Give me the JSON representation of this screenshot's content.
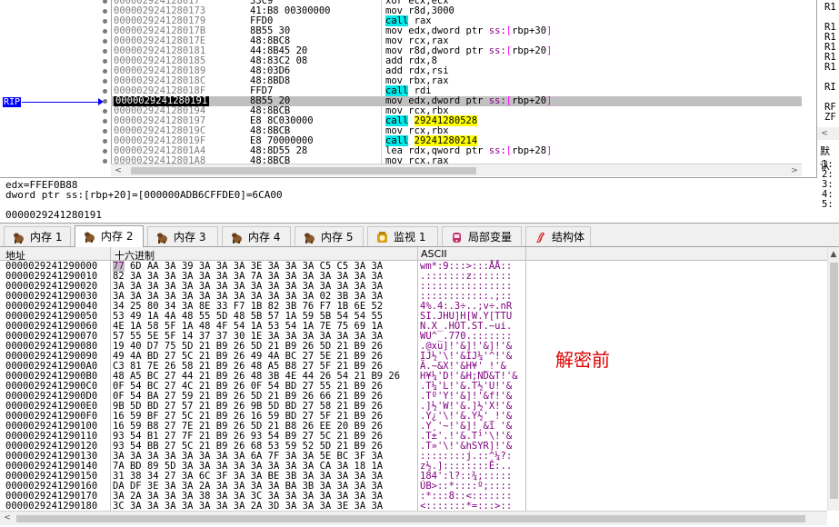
{
  "disasm": {
    "rip_label": "RIP",
    "rows": [
      {
        "addr": "000002924128017",
        "bytes": "33C9",
        "instr": "xor ecx,ecx"
      },
      {
        "addr": "0000029241280173",
        "bytes": "41:B8 00300000",
        "instr": "mov r8d,3000"
      },
      {
        "addr": "0000029241280179",
        "bytes": "FFD0",
        "instr": "call rax"
      },
      {
        "addr": "000002924128017B",
        "bytes": "8B55 30",
        "instr": "mov edx,dword ptr ss:[rbp+30]"
      },
      {
        "addr": "000002924128017E",
        "bytes": "48:8BC8",
        "instr": "mov rcx,rax"
      },
      {
        "addr": "0000029241280181",
        "bytes": "44:8B45 20",
        "instr": "mov r8d,dword ptr ss:[rbp+20]"
      },
      {
        "addr": "0000029241280185",
        "bytes": "48:83C2 08",
        "instr": "add rdx,8"
      },
      {
        "addr": "0000029241280189",
        "bytes": "48:03D6",
        "instr": "add rdx,rsi"
      },
      {
        "addr": "000002924128018C",
        "bytes": "48:8BD8",
        "instr": "mov rbx,rax"
      },
      {
        "addr": "000002924128018F",
        "bytes": "FFD7",
        "instr": "call rdi"
      },
      {
        "addr": "0000029241280191",
        "bytes": "8B55 20",
        "instr": "mov edx,dword ptr ss:[rbp+20]"
      },
      {
        "addr": "0000029241280194",
        "bytes": "48:8BCB",
        "instr": "mov rcx,rbx"
      },
      {
        "addr": "0000029241280197",
        "bytes": "E8 8C030000",
        "instr": "call 29241280528"
      },
      {
        "addr": "000002924128019C",
        "bytes": "48:8BCB",
        "instr": "mov rcx,rbx"
      },
      {
        "addr": "000002924128019F",
        "bytes": "E8 70000000",
        "instr": "call 29241280214"
      },
      {
        "addr": "00000292412801A4",
        "bytes": "48:8D55 28",
        "instr": "lea rdx,qword ptr ss:[rbp+28]"
      },
      {
        "addr": "00000292412801A8",
        "bytes": "48:8BCB",
        "instr": "mov rcx,rax"
      }
    ]
  },
  "registers": {
    "labels": [
      "R1",
      "R1",
      "R1",
      "R1",
      "R1",
      "R1",
      "RI",
      "RF",
      "ZF"
    ],
    "default_label": "默认",
    "stack": [
      "1:",
      "2:",
      "3:",
      "4:",
      "5:"
    ]
  },
  "info": {
    "line1": "edx=FFEF0B88",
    "line2": "dword ptr ss:[rbp+20]=[000000ADB6CFFDE0]=6CA00",
    "line3": "0000029241280191"
  },
  "tabs": [
    {
      "label": "内存 1",
      "icon": "memory-icon"
    },
    {
      "label": "内存 2",
      "icon": "memory-icon"
    },
    {
      "label": "内存 3",
      "icon": "memory-icon"
    },
    {
      "label": "内存 4",
      "icon": "memory-icon"
    },
    {
      "label": "内存 5",
      "icon": "memory-icon"
    },
    {
      "label": "监视 1",
      "icon": "watch-icon"
    },
    {
      "label": "局部变量",
      "icon": "locals-icon"
    },
    {
      "label": "结构体",
      "icon": "struct-icon"
    }
  ],
  "active_tab": 1,
  "dump": {
    "headers": {
      "address": "地址",
      "hex": "十六进制",
      "ascii": "ASCII"
    },
    "note": "解密前",
    "rows": [
      {
        "addr": "0000029241290000",
        "hex": "77 6D AA 3A 39 3A 3A 3A 3E 3A 3A 3A C5 C5 3A 3A",
        "ascii": "wm*:9:::>:::ÅÅ::"
      },
      {
        "addr": "0000029241290010",
        "hex": "82 3A 3A 3A 3A 3A 3A 3A 7A 3A 3A 3A 3A 3A 3A 3A",
        "ascii": ".:::::::z:::::::"
      },
      {
        "addr": "0000029241290020",
        "hex": "3A 3A 3A 3A 3A 3A 3A 3A 3A 3A 3A 3A 3A 3A 3A 3A",
        "ascii": "::::::::::::::::"
      },
      {
        "addr": "0000029241290030",
        "hex": "3A 3A 3A 3A 3A 3A 3A 3A 3A 3A 3A 3A 02 3B 3A 3A",
        "ascii": "::::::::::::.;::"
      },
      {
        "addr": "0000029241290040",
        "hex": "34 25 80 34 3A 8E 33 F7 1B 82 3B 76 F7 1B 6E 52",
        "ascii": "4%.4:.3÷..;v÷.nR"
      },
      {
        "addr": "0000029241290050",
        "hex": "53 49 1A 4A 48 55 5D 48 5B 57 1A 59 5B 54 54 55",
        "ascii": "SI.JHU]H[W.Y[TTU"
      },
      {
        "addr": "0000029241290060",
        "hex": "4E 1A 58 5F 1A 48 4F 54 1A 53 54 1A 7E 75 69 1A",
        "ascii": "N.X_.HOT.ST.~ui."
      },
      {
        "addr": "0000029241290070",
        "hex": "57 55 5E 5F 14 37 37 30 1E 3A 3A 3A 3A 3A 3A 3A",
        "ascii": "WU^_.770.:::::::"
      },
      {
        "addr": "0000029241290080",
        "hex": "19 40 D7 75 5D 21 B9 26 5D 21 B9 26 5D 21 B9 26",
        "ascii": ".@xu]!'&]!'&]!'&"
      },
      {
        "addr": "0000029241290090",
        "hex": "49 4A BD 27 5C 21 B9 26 49 4A BC 27 5E 21 B9 26",
        "ascii": "IJ½'\\!'&IJ¼'^!'&"
      },
      {
        "addr": "00000292412900A0",
        "hex": "C3 81 7E 26 58 21 B9 26 48 A5 B8 27 5F 21 B9 26",
        "ascii": "Ã.~&X!'&H¥'_!'&"
      },
      {
        "addr": "00000292412900B0",
        "hex": "48 A5 BC 27 44 21 B9 26 48 3B 4E 44 26 54 21 B9 26",
        "ascii": "H¥¼'D!'&H;ND&T!'&"
      },
      {
        "addr": "00000292412900C0",
        "hex": "0F 54 BC 27 4C 21 B9 26 0F 54 BD 27 55 21 B9 26",
        "ascii": ".T¼'L!'&.T½'U!'&"
      },
      {
        "addr": "00000292412900D0",
        "hex": "0F 54 BA 27 59 21 B9 26 5D 21 B9 26 66 21 B9 26",
        "ascii": ".Tº'Y!'&]!'&f!'&"
      },
      {
        "addr": "00000292412900E0",
        "hex": "9B 5D BD 27 57 21 B9 26 9B 5D BD 27 58 21 B9 26",
        "ascii": ".]½'W!'&.]½'X!'&"
      },
      {
        "addr": "00000292412900F0",
        "hex": "16 59 BF 27 5C 21 B9 26 16 59 BD 27 5F 21 B9 26",
        "ascii": ".Y¿'\\!'&.Y½'_!'&"
      },
      {
        "addr": "0000029241290100",
        "hex": "16 59 B8 27 7E 21 B9 26 5D 21 B8 26 EE 20 B9 26",
        "ascii": ".Y¸'~!'&]!¸&î '&"
      },
      {
        "addr": "0000029241290110",
        "hex": "93 54 B1 27 7F 21 B9 26 93 54 B9 27 5C 21 B9 26",
        "ascii": ".T±'.!'&.T¹'\\!'&"
      },
      {
        "addr": "0000029241290120",
        "hex": "93 54 BB 27 5C 21 B9 26 68 53 59 52 5D 21 B9 26",
        "ascii": ".T»'\\!'&hSYR]!'&"
      },
      {
        "addr": "0000029241290130",
        "hex": "3A 3A 3A 3A 3A 3A 3A 3A 6A 7F 3A 3A 5E BC 3F 3A",
        "ascii": "::::::::j.::^¼?:"
      },
      {
        "addr": "0000029241290140",
        "hex": "7A BD 89 5D 3A 3A 3A 3A 3A 3A 3A 3A CA 3A 18 1A",
        "ascii": "z½.]::::::::Ê:.."
      },
      {
        "addr": "0000029241290150",
        "hex": "31 38 34 27 3A 6C 3F 3A 3A BE 3B 3A 3A 3A 3A 3A",
        "ascii": "184':l?::¾;:::::"
      },
      {
        "addr": "0000029241290160",
        "hex": "DA DF 3E 3A 3A 2A 3A 3A 3A 3A BA 3B 3A 3A 3A 3A",
        "ascii": "ÚB>::*::::º;::::"
      },
      {
        "addr": "0000029241290170",
        "hex": "3A 2A 3A 3A 3A 38 3A 3A 3C 3A 3A 3A 3A 3A 3A 3A",
        "ascii": ":*:::8::<:::::::"
      },
      {
        "addr": "0000029241290180",
        "hex": "3C 3A 3A 3A 3A 3A 3A 3A 2A 3D 3A 3A 3A 3E 3A 3A",
        "ascii": "<:::::::*=:::>::"
      }
    ]
  }
}
